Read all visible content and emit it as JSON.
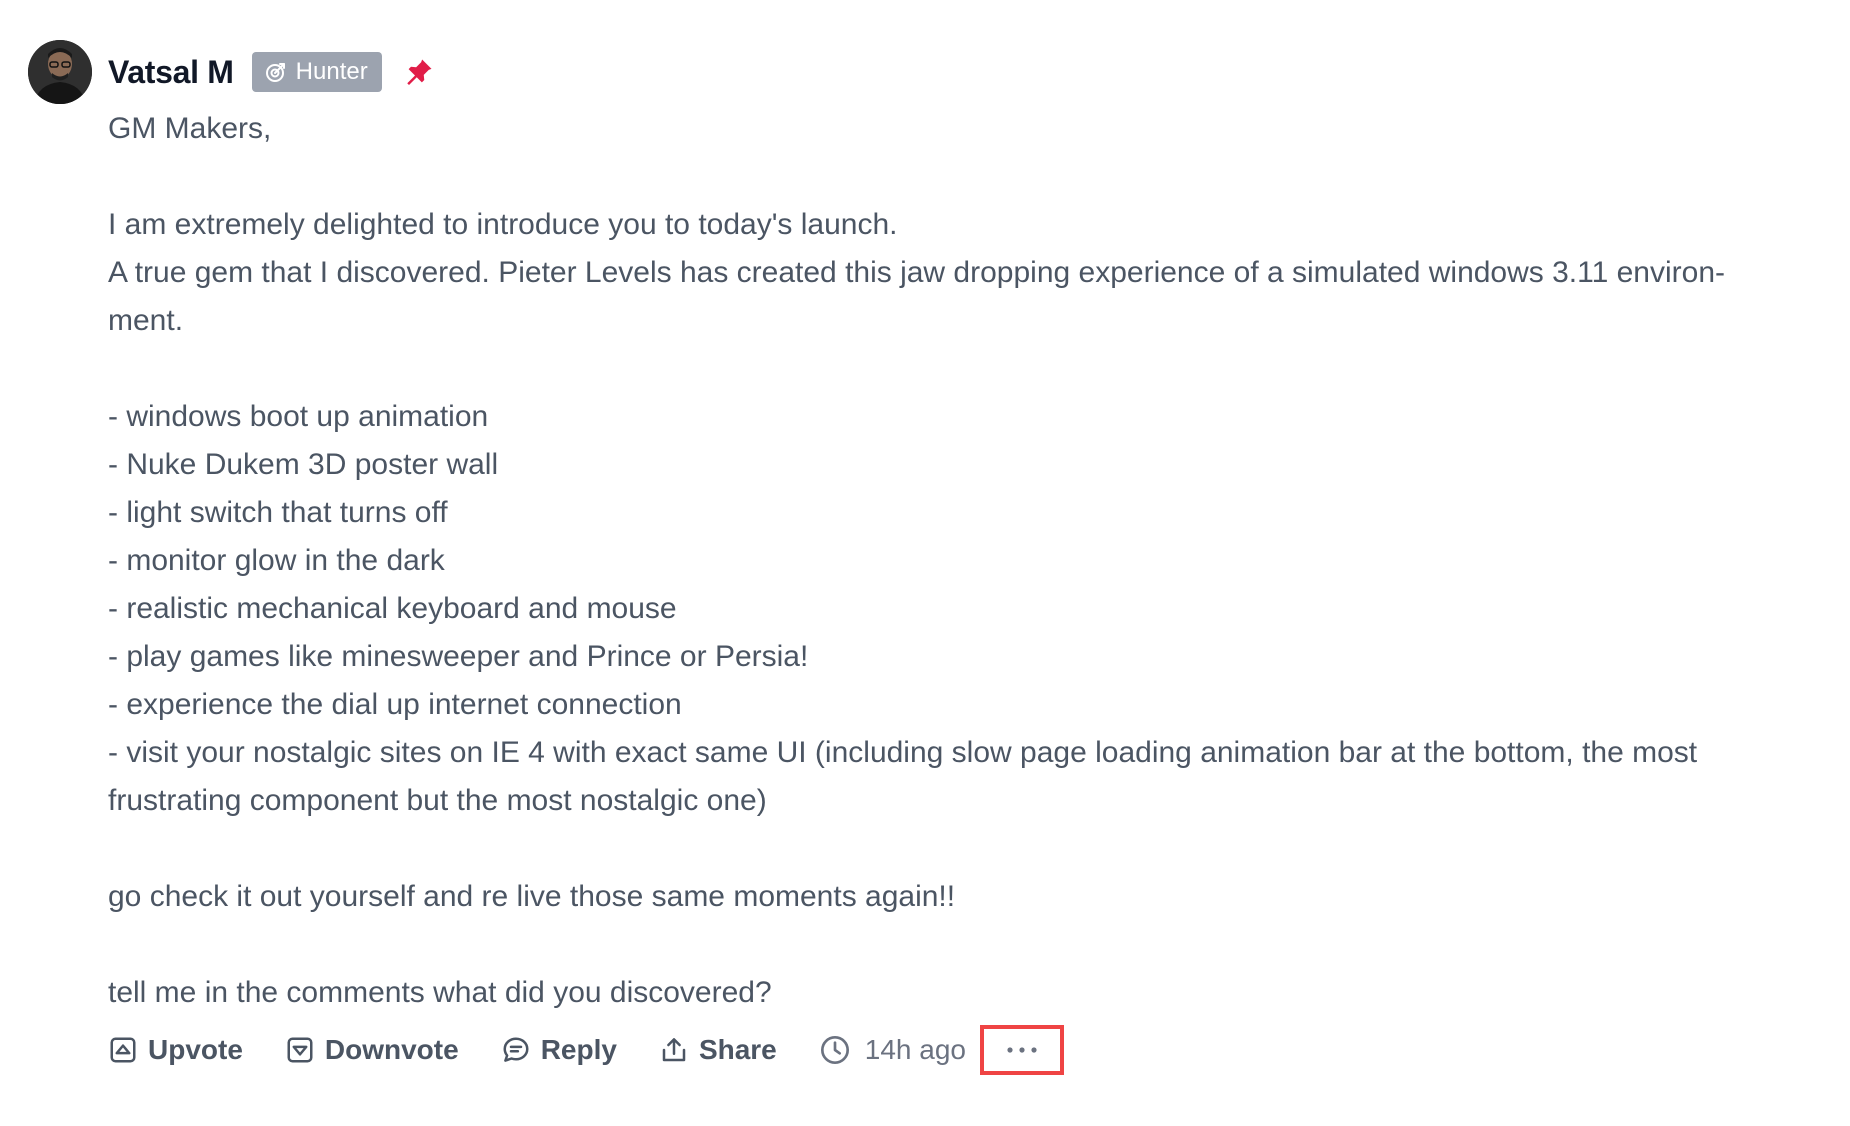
{
  "comment": {
    "author": "Vatsal M",
    "badge": "Hunter",
    "body": [
      "GM Makers,",
      "",
      "I am extremely delighted to introduce you to today's launch.",
      "A true gem that I discovered. Pieter Levels has created this jaw dropping experience of a simulated windows 3.11 environ-",
      "ment.",
      "",
      "- windows boot up animation",
      "- Nuke Dukem 3D poster wall",
      "- light switch that turns off",
      "- monitor glow in the dark",
      "- realistic mechanical keyboard and mouse",
      "- play games like minesweeper and Prince or Persia!",
      "- experience the dial up internet connection",
      "- visit your nostalgic sites on IE 4 with exact same UI (including slow page loading animation bar at the bottom, the most",
      "frustrating component but the most nostalgic one)",
      "",
      "go check it out yourself and re live those same moments again!!",
      "",
      "tell me in the comments what did you discovered?"
    ],
    "actions": {
      "upvote": "Upvote",
      "downvote": "Downvote",
      "reply": "Reply",
      "share": "Share",
      "timestamp": "14h ago"
    }
  },
  "icons": {
    "avatar": "avatar",
    "badge": "target-icon",
    "pin": "pin-icon",
    "upvote": "upvote-icon",
    "downvote": "downvote-icon",
    "reply": "reply-icon",
    "share": "share-icon",
    "timestamp": "clock-icon",
    "more": "more-icon"
  },
  "colors": {
    "badge_bg": "#9ca3af",
    "pin": "#e11d48",
    "highlight": "#ef4444"
  }
}
